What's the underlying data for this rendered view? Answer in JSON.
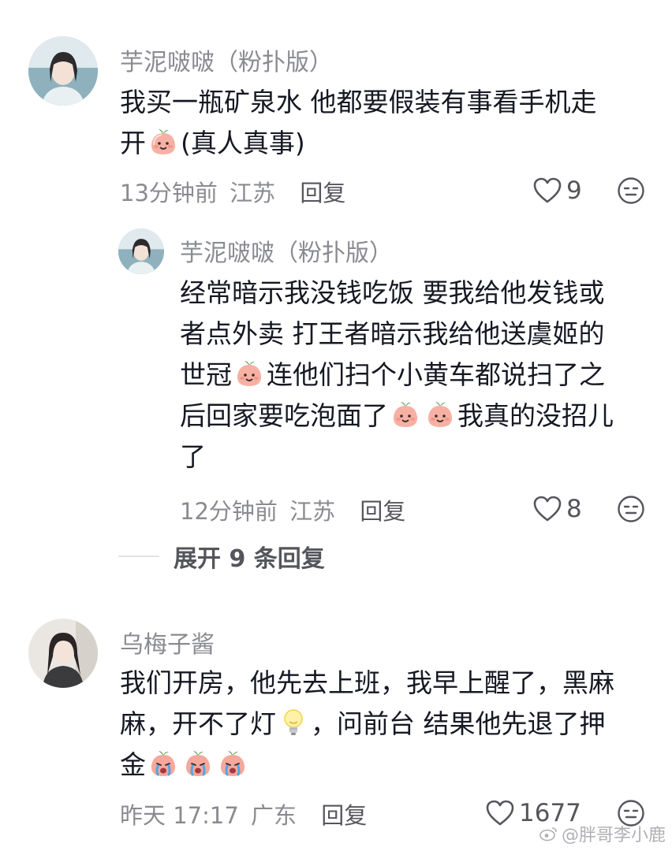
{
  "comments": [
    {
      "username": "芋泥啵啵（粉扑版）",
      "lines": [
        [
          "我买一瓶矿泉水  他都要假装有事看手机走"
        ],
        [
          "开",
          "peach-smile-emoji",
          "(真人真事)"
        ]
      ],
      "time": "13分钟前",
      "location": "江苏",
      "reply_label": "回复",
      "likes": "9",
      "reply": {
        "username": "芋泥啵啵（粉扑版）",
        "lines": [
          [
            "经常暗示我没钱吃饭  要我给他发钱或"
          ],
          [
            "者点外卖  打王者暗示我给他送虞姬的"
          ],
          [
            "世冠",
            "peach-smile-emoji",
            "连他们扫个小黄车都说扫了之"
          ],
          [
            "后回家要吃泡面了",
            "peach-smile-emoji",
            "peach-smile-emoji",
            "我真的没招儿"
          ],
          [
            "了"
          ]
        ],
        "time": "12分钟前",
        "location": "江苏",
        "reply_label": "回复",
        "likes": "8"
      },
      "expand_label": "展开 9 条回复"
    },
    {
      "username": "乌梅子酱",
      "lines": [
        [
          "我们开房，他先去上班，我早上醒了，黑麻"
        ],
        [
          "麻，开不了灯",
          "light-bulb-emoji",
          "，问前台 结果他先退了押"
        ],
        [
          "金",
          "peach-crying-emoji",
          "peach-crying-emoji",
          "peach-crying-emoji"
        ]
      ],
      "time": "昨天 17:17",
      "location": "广东",
      "reply_label": "回复",
      "likes": "1677"
    }
  ],
  "watermark": "@胖哥李小鹿",
  "colors": {
    "text": "#161823",
    "secondary": "#8a8b91",
    "peach": "#f4a49a"
  }
}
